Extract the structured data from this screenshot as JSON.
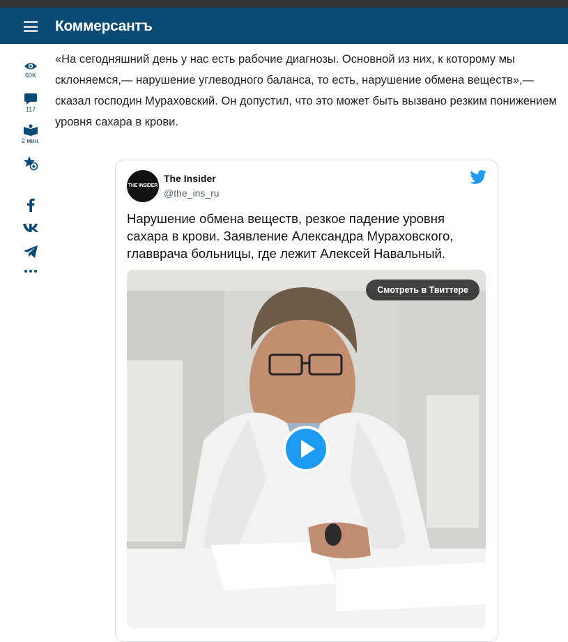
{
  "header": {
    "logo": "Коммерсантъ"
  },
  "sidebar": {
    "views": "60K",
    "comments": "117",
    "read_time": "2 мин."
  },
  "article": {
    "paragraph": "«На сегодняшний день у нас есть рабочие диагнозы. Основной из них, к которому мы склоняемся,— нарушение углеводного баланса, то есть, нарушение обмена веществ»,— сказал господин Мураховский. Он допустил, что это может быть вызвано резким понижением уровня сахара в крови."
  },
  "tweet": {
    "avatar_text": "THE INSIDER",
    "author_name": "The Insider",
    "author_handle": "@the_ins_ru",
    "text": "Нарушение обмена веществ, резкое падение уровня сахара в крови. Заявление Александра Мураховского, главврача больницы, где лежит Алексей Навальный.",
    "watch_button": "Смотреть в Твиттере"
  },
  "colors": {
    "header_bg": "#0a4a74",
    "accent": "#0a4a74",
    "twitter_blue": "#1d9bf0"
  }
}
